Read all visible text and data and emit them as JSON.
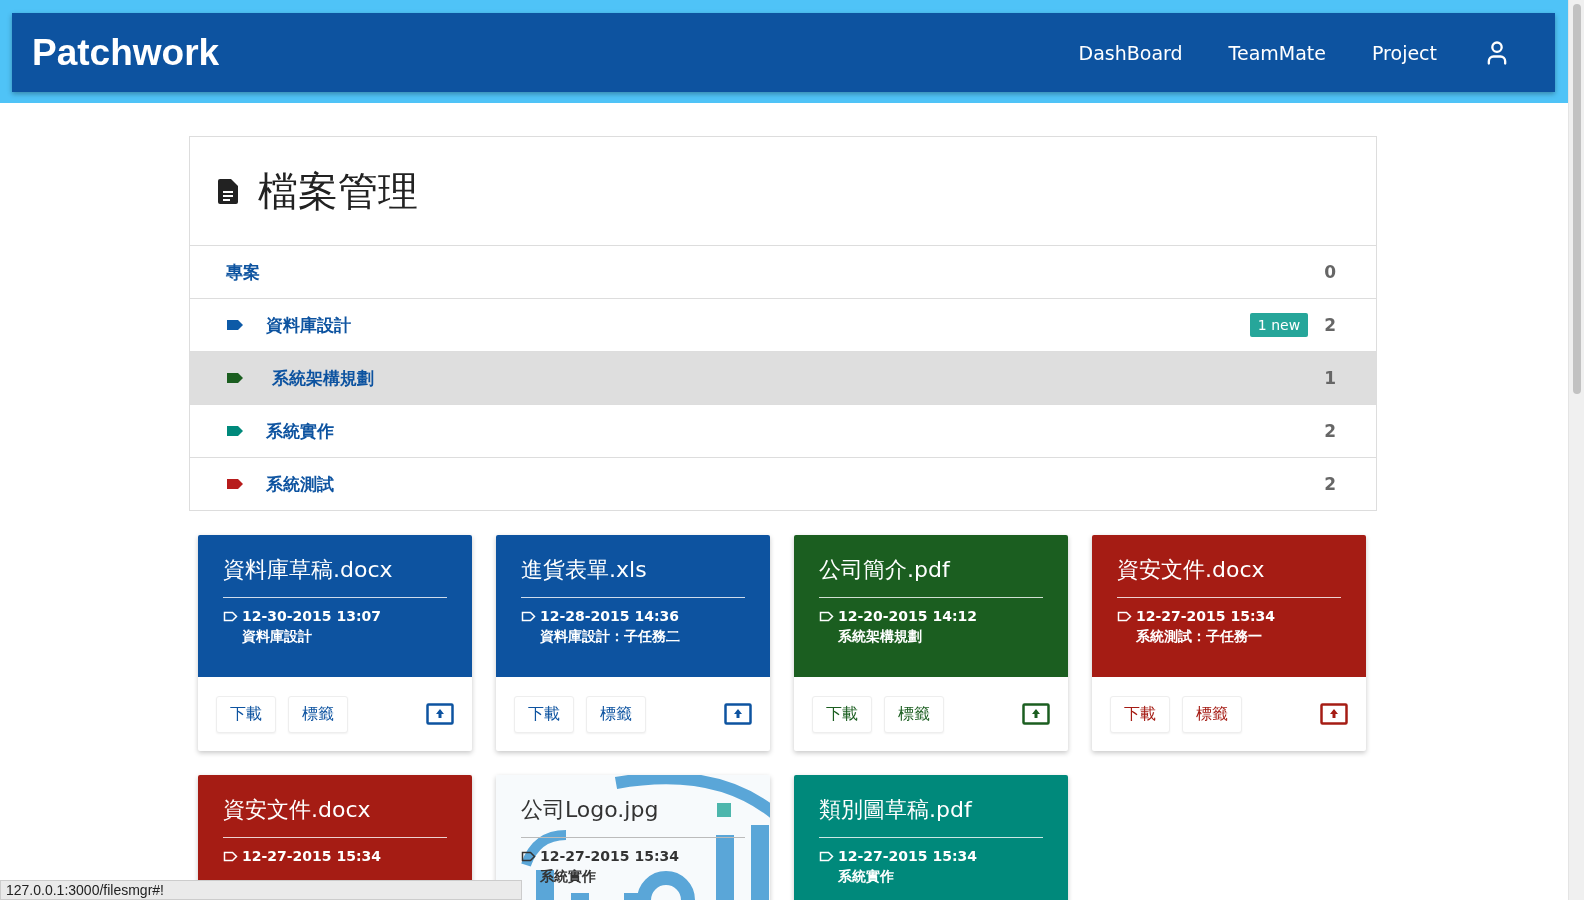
{
  "navbar": {
    "brand": "Patchwork",
    "links": [
      "DashBoard",
      "TeamMate",
      "Project"
    ]
  },
  "panel": {
    "title": "檔案管理",
    "header_row": {
      "label": "專案",
      "count": "0"
    },
    "categories": [
      {
        "name": "資料庫設計",
        "color": "#0d5aa7",
        "badge": "1 new",
        "count": "2",
        "selected": false
      },
      {
        "name": "系統架構規劃",
        "color": "#1b5e20",
        "count": "1",
        "selected": true
      },
      {
        "name": "系統實作",
        "color": "#00897b",
        "count": "2",
        "selected": false
      },
      {
        "name": "系統測試",
        "color": "#b71c1c",
        "count": "2",
        "selected": false
      }
    ]
  },
  "files": [
    {
      "kind": "plain",
      "name": "資料庫草稿.docx",
      "color": "#0d53a0",
      "date": "12-30-2015 13:07",
      "task": "資料庫設計",
      "actions": [
        "下載",
        "標籤"
      ]
    },
    {
      "kind": "plain",
      "name": "進貨表單.xls",
      "color": "#0d53a0",
      "date": "12-28-2015 14:36",
      "task": "資料庫設計：子任務二",
      "actions": [
        "下載",
        "標籤"
      ]
    },
    {
      "kind": "plain",
      "name": "公司簡介.pdf",
      "color": "#1b5e20",
      "date": "12-20-2015 14:12",
      "task": "系統架構規劃",
      "actions": [
        "下載",
        "標籤"
      ]
    },
    {
      "kind": "plain",
      "name": "資安文件.docx",
      "color": "#a51c14",
      "date": "12-27-2015 15:34",
      "task": "系統測試：子任務一",
      "actions": [
        "下載",
        "標籤"
      ]
    },
    {
      "kind": "plain",
      "name": "資安文件.docx",
      "color": "#a51c14",
      "date": "12-27-2015 15:34"
    },
    {
      "kind": "picture",
      "name": "公司Logo.jpg",
      "color": "#4db6ac",
      "date": "12-27-2015 15:34",
      "task": "系統實作"
    },
    {
      "kind": "plain",
      "name": "類別圖草稿.pdf",
      "color": "#00897b",
      "date": "12-27-2015 15:34",
      "task": "系統實作"
    }
  ],
  "status_bar": {
    "url": "127.0.0.1:3000/filesmgr#!"
  }
}
